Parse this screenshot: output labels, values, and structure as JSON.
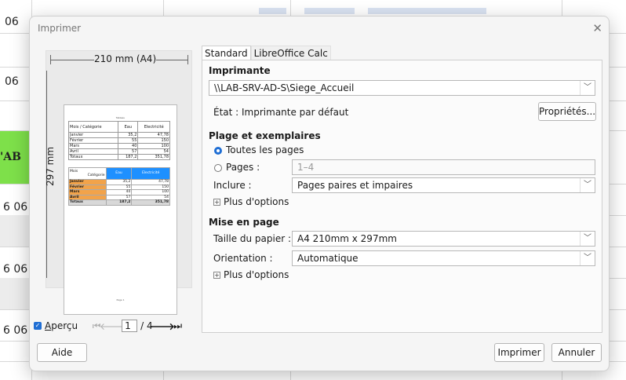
{
  "background": {
    "row_labels": [
      "06",
      "06",
      "'AB",
      "6 06",
      "6 06",
      "6 06"
    ]
  },
  "dialog": {
    "title": "Imprimer",
    "close_glyph": "✕"
  },
  "preview": {
    "width_label": "210 mm (A4)",
    "height_label": "297 mm",
    "mini_title": "Tableau",
    "table1": {
      "headers": [
        "Mois / Catégorie",
        "Eau",
        "Electricité"
      ],
      "rows": [
        [
          "Janvier",
          "35,2",
          "47,78"
        ],
        [
          "Février",
          "55",
          "150"
        ],
        [
          "Mars",
          "40",
          "100"
        ],
        [
          "Avril",
          "57",
          "54"
        ],
        [
          "Totaux",
          "187,2",
          "351,78"
        ]
      ]
    },
    "table2": {
      "header_line1": "Mois",
      "header_line2": "Catégorie",
      "headers": [
        "Eau",
        "Electricité"
      ],
      "rows": [
        [
          "Janvier",
          "35,2",
          "47,78"
        ],
        [
          "Février",
          "55",
          "150"
        ],
        [
          "Mars",
          "40",
          "100"
        ],
        [
          "Avril",
          "57",
          "54"
        ],
        [
          "Totaux",
          "187,2",
          "351,78"
        ]
      ]
    },
    "page_footer": "Page 1",
    "nav": {
      "apercu_label": "Aperçu",
      "first_glyph": "⏮",
      "prev_glyph": "🡐",
      "next_glyph": "🡒",
      "last_glyph": "⏭",
      "current_page": "1",
      "total": "/ 4"
    }
  },
  "tabs": [
    "Standard",
    "LibreOffice Calc"
  ],
  "printer": {
    "section": "Imprimante",
    "selected": "\\\\LAB-SRV-AD-S\\Siege_Accueil",
    "status": "État : Imprimante par défaut",
    "properties_button": "Propriétés..."
  },
  "range": {
    "section": "Plage et exemplaires",
    "all_pages": "Toutes les pages",
    "pages_label": "Pages :",
    "pages_placeholder": "1–4",
    "include_label": "Inclure :",
    "include_value": "Pages paires et impaires",
    "more_options": "Plus d'options"
  },
  "layout": {
    "section": "Mise en page",
    "paper_label": "Taille du papier :",
    "paper_value": "A4 210mm x 297mm",
    "orientation_label": "Orientation :",
    "orientation_value": "Automatique",
    "more_options": "Plus d'options"
  },
  "footer": {
    "help": "Aide",
    "print": "Imprimer",
    "cancel": "Annuler"
  },
  "colors": {
    "accent": "#1f6ed4",
    "sheet_green": "#7ee04a",
    "table_header_blue": "#1e90ff",
    "table_orange": "#f2a34a"
  }
}
